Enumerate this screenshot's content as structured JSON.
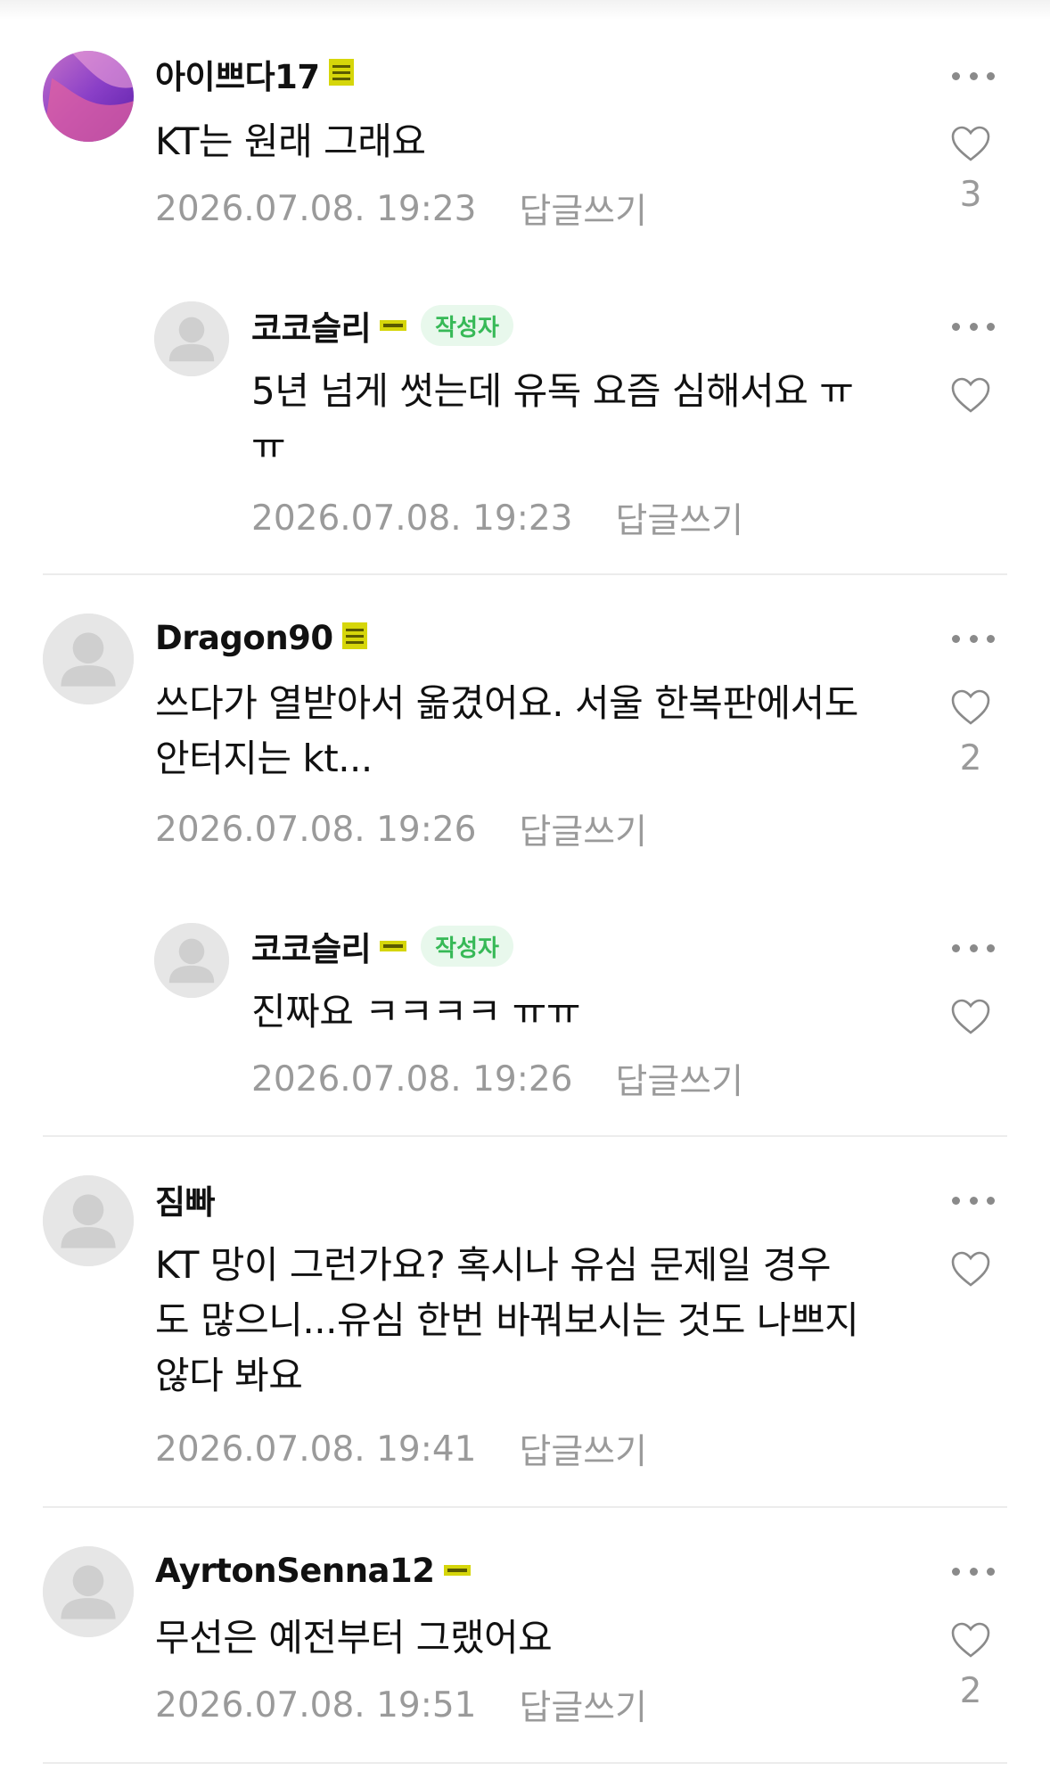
{
  "comments": [
    {
      "author": "아이쁘다17",
      "level_icon": "level-stack-icon",
      "text": "KT는 원래 그래요",
      "date": "2026.07.08. 19:23",
      "reply": "답글쓰기",
      "likes": "3",
      "avatar": "gradient-wave"
    },
    {
      "author": "코코슬리",
      "level_icon": "level-bar-icon",
      "badge": "작성자",
      "text": "5년 넘게 썻는데 유독 요즘 심해서요 ㅠ\nㅠ",
      "date": "2026.07.08. 19:23",
      "reply": "답글쓰기",
      "likes": "",
      "avatar": "default"
    },
    {
      "author": "Dragon90",
      "level_icon": "level-stack-icon",
      "text": "쓰다가 열받아서 옮겼어요. 서울 한복판에서도\n안터지는 kt...",
      "date": "2026.07.08. 19:26",
      "reply": "답글쓰기",
      "likes": "2",
      "avatar": "default"
    },
    {
      "author": "코코슬리",
      "level_icon": "level-bar-icon",
      "badge": "작성자",
      "text": "진짜요 ㅋㅋㅋㅋ ㅠㅠ",
      "date": "2026.07.08. 19:26",
      "reply": "답글쓰기",
      "likes": "",
      "avatar": "default"
    },
    {
      "author": "짐빠",
      "text": "KT 망이 그런가요? 혹시나 유심 문제일 경우\n도 많으니...유심 한번 바꿔보시는 것도 나쁘지\n않다 봐요",
      "date": "2026.07.08. 19:41",
      "reply": "답글쓰기",
      "likes": "",
      "avatar": "default"
    },
    {
      "author": "AyrtonSenna12",
      "level_icon": "level-bar-icon",
      "text": "무선은 예전부터 그랬어요",
      "date": "2026.07.08. 19:51",
      "reply": "답글쓰기",
      "likes": "2",
      "avatar": "default"
    }
  ],
  "colors": {
    "badge_bg": "#e8f8ec",
    "badge_text": "#37b957",
    "level_yellow": "#d6d60a",
    "meta_gray": "#9a9a9a"
  }
}
